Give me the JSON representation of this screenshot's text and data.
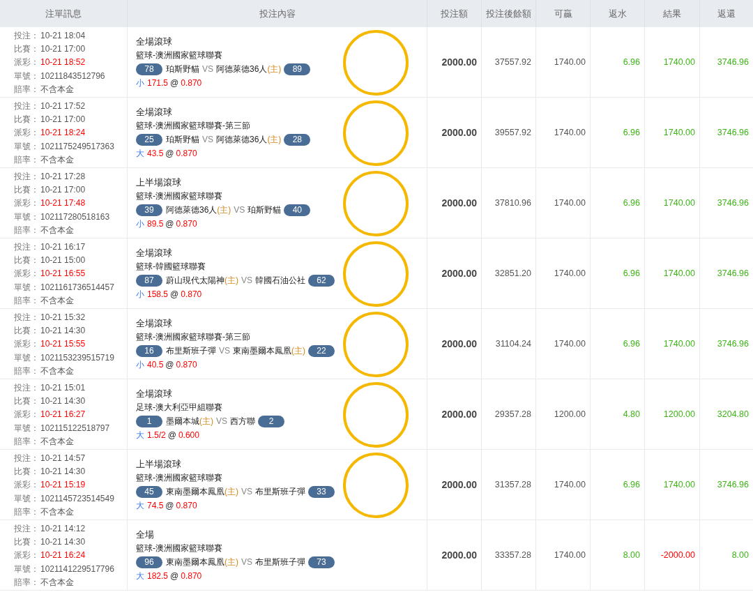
{
  "columns": [
    "注單訊息",
    "投注內容",
    "投注額",
    "投注後餘額",
    "可贏",
    "返水",
    "結果",
    "返還"
  ],
  "rows": [
    {
      "info": [
        {
          "label": "投注：",
          "value": "10-21 18:04",
          "highlight": false
        },
        {
          "label": "比賽：",
          "value": "10-21 17:00",
          "highlight": false
        },
        {
          "label": "派彩：",
          "value": "10-21 18:52",
          "highlight": true
        },
        {
          "label": "單號：",
          "value": "10211843512796",
          "highlight": false
        },
        {
          "label": "賠率：",
          "value": "不含本金",
          "highlight": false
        }
      ],
      "bet_type": "全場滾球",
      "league": "籃球-澳洲國家籃球聯賽",
      "teams": [
        {
          "score": "78",
          "name": "珀斯野貓"
        },
        {
          "name": "阿德萊德36人",
          "home_mark": "(主)",
          "score": "89"
        }
      ],
      "vs": "VS",
      "side": "小",
      "line": "171.5",
      "at": "@",
      "odds": "0.870",
      "circled": true,
      "amount": "2000.00",
      "balance": "37557.92",
      "win": "1740.00",
      "rebate": "6.96",
      "result": "1740.00",
      "negative": false,
      "returned": "3746.96"
    },
    {
      "info": [
        {
          "label": "投注：",
          "value": "10-21 17:52",
          "highlight": false
        },
        {
          "label": "比賽：",
          "value": "10-21 17:00",
          "highlight": false
        },
        {
          "label": "派彩：",
          "value": "10-21 18:24",
          "highlight": true
        },
        {
          "label": "單號：",
          "value": "1021175249517363",
          "highlight": false
        },
        {
          "label": "賠率：",
          "value": "不含本金",
          "highlight": false
        }
      ],
      "bet_type": "全場滾球",
      "league": "籃球-澳洲國家籃球聯賽-第三節",
      "teams": [
        {
          "score": "25",
          "name": "珀斯野貓"
        },
        {
          "name": "阿德萊德36人",
          "home_mark": "(主)",
          "score": "28"
        }
      ],
      "vs": "VS",
      "side": "大",
      "line": "43.5",
      "at": "@",
      "odds": "0.870",
      "circled": true,
      "amount": "2000.00",
      "balance": "39557.92",
      "win": "1740.00",
      "rebate": "6.96",
      "result": "1740.00",
      "negative": false,
      "returned": "3746.96"
    },
    {
      "info": [
        {
          "label": "投注：",
          "value": "10-21 17:28",
          "highlight": false
        },
        {
          "label": "比賽：",
          "value": "10-21 17:00",
          "highlight": false
        },
        {
          "label": "派彩：",
          "value": "10-21 17:48",
          "highlight": true
        },
        {
          "label": "單號：",
          "value": "102117280518163",
          "highlight": false
        },
        {
          "label": "賠率：",
          "value": "不含本金",
          "highlight": false
        }
      ],
      "bet_type": "上半場滾球",
      "league": "籃球-澳洲國家籃球聯賽",
      "teams": [
        {
          "score": "39",
          "name": "阿德萊德36人",
          "home_mark": "(主)"
        },
        {
          "name": "珀斯野貓",
          "score": "40"
        }
      ],
      "vs": "VS",
      "side": "小",
      "line": "89.5",
      "at": "@",
      "odds": "0.870",
      "circled": true,
      "amount": "2000.00",
      "balance": "37810.96",
      "win": "1740.00",
      "rebate": "6.96",
      "result": "1740.00",
      "negative": false,
      "returned": "3746.96"
    },
    {
      "info": [
        {
          "label": "投注：",
          "value": "10-21 16:17",
          "highlight": false
        },
        {
          "label": "比賽：",
          "value": "10-21 15:00",
          "highlight": false
        },
        {
          "label": "派彩：",
          "value": "10-21 16:55",
          "highlight": true
        },
        {
          "label": "單號：",
          "value": "1021161736514457",
          "highlight": false
        },
        {
          "label": "賠率：",
          "value": "不含本金",
          "highlight": false
        }
      ],
      "bet_type": "全場滾球",
      "league": "籃球-韓國籃球聯賽",
      "teams": [
        {
          "score": "87",
          "name": "蔚山現代太陽神",
          "home_mark": "(主)"
        },
        {
          "name": "韓國石油公社",
          "score": "62"
        }
      ],
      "vs": "VS",
      "side": "小",
      "line": "158.5",
      "at": "@",
      "odds": "0.870",
      "circled": true,
      "amount": "2000.00",
      "balance": "32851.20",
      "win": "1740.00",
      "rebate": "6.96",
      "result": "1740.00",
      "negative": false,
      "returned": "3746.96"
    },
    {
      "info": [
        {
          "label": "投注：",
          "value": "10-21 15:32",
          "highlight": false
        },
        {
          "label": "比賽：",
          "value": "10-21 14:30",
          "highlight": false
        },
        {
          "label": "派彩：",
          "value": "10-21 15:55",
          "highlight": true
        },
        {
          "label": "單號：",
          "value": "1021153239515719",
          "highlight": false
        },
        {
          "label": "賠率：",
          "value": "不含本金",
          "highlight": false
        }
      ],
      "bet_type": "全場滾球",
      "league": "籃球-澳洲國家籃球聯賽-第三節",
      "teams": [
        {
          "score": "16",
          "name": "布里斯班子彈"
        },
        {
          "name": "東南墨爾本鳳凰",
          "home_mark": "(主)",
          "score": "22"
        }
      ],
      "vs": "VS",
      "side": "小",
      "line": "40.5",
      "at": "@",
      "odds": "0.870",
      "circled": true,
      "amount": "2000.00",
      "balance": "31104.24",
      "win": "1740.00",
      "rebate": "6.96",
      "result": "1740.00",
      "negative": false,
      "returned": "3746.96"
    },
    {
      "info": [
        {
          "label": "投注：",
          "value": "10-21 15:01",
          "highlight": false
        },
        {
          "label": "比賽：",
          "value": "10-21 14:30",
          "highlight": false
        },
        {
          "label": "派彩：",
          "value": "10-21 16:27",
          "highlight": true
        },
        {
          "label": "單號：",
          "value": "102115122518797",
          "highlight": false
        },
        {
          "label": "賠率：",
          "value": "不含本金",
          "highlight": false
        }
      ],
      "bet_type": "全場滾球",
      "league": "足球-澳大利亞甲組聯賽",
      "teams": [
        {
          "score": "1",
          "name": "墨爾本城",
          "home_mark": "(主)"
        },
        {
          "name": "西方聯",
          "score": "2"
        }
      ],
      "vs": "VS",
      "side": "大",
      "line": "1.5/2",
      "at": "@",
      "odds": "0.600",
      "circled": true,
      "amount": "2000.00",
      "balance": "29357.28",
      "win": "1200.00",
      "rebate": "4.80",
      "result": "1200.00",
      "negative": false,
      "returned": "3204.80"
    },
    {
      "info": [
        {
          "label": "投注：",
          "value": "10-21 14:57",
          "highlight": false
        },
        {
          "label": "比賽：",
          "value": "10-21 14:30",
          "highlight": false
        },
        {
          "label": "派彩：",
          "value": "10-21 15:19",
          "highlight": true
        },
        {
          "label": "單號：",
          "value": "1021145723514549",
          "highlight": false
        },
        {
          "label": "賠率：",
          "value": "不含本金",
          "highlight": false
        }
      ],
      "bet_type": "上半場滾球",
      "league": "籃球-澳洲國家籃球聯賽",
      "teams": [
        {
          "score": "45",
          "name": "東南墨爾本鳳凰",
          "home_mark": "(主)"
        },
        {
          "name": "布里斯班子彈",
          "score": "33"
        }
      ],
      "vs": "VS",
      "side": "大",
      "line": "74.5",
      "at": "@",
      "odds": "0.870",
      "circled": true,
      "amount": "2000.00",
      "balance": "31357.28",
      "win": "1740.00",
      "rebate": "6.96",
      "result": "1740.00",
      "negative": false,
      "returned": "3746.96"
    },
    {
      "info": [
        {
          "label": "投注：",
          "value": "10-21 14:12",
          "highlight": false
        },
        {
          "label": "比賽：",
          "value": "10-21 14:30",
          "highlight": false
        },
        {
          "label": "派彩：",
          "value": "10-21 16:24",
          "highlight": true
        },
        {
          "label": "單號：",
          "value": "1021141229517796",
          "highlight": false
        },
        {
          "label": "賠率：",
          "value": "不含本金",
          "highlight": false
        }
      ],
      "bet_type": "全場",
      "league": "籃球-澳洲國家籃球聯賽",
      "teams": [
        {
          "score": "96",
          "name": "東南墨爾本鳳凰",
          "home_mark": "(主)"
        },
        {
          "name": "布里斯班子彈",
          "score": "73"
        }
      ],
      "vs": "VS",
      "side": "大",
      "line": "182.5",
      "at": "@",
      "odds": "0.870",
      "circled": false,
      "amount": "2000.00",
      "balance": "33357.28",
      "win": "1740.00",
      "rebate": "8.00",
      "result": "-2000.00",
      "negative": true,
      "returned": "8.00"
    }
  ]
}
